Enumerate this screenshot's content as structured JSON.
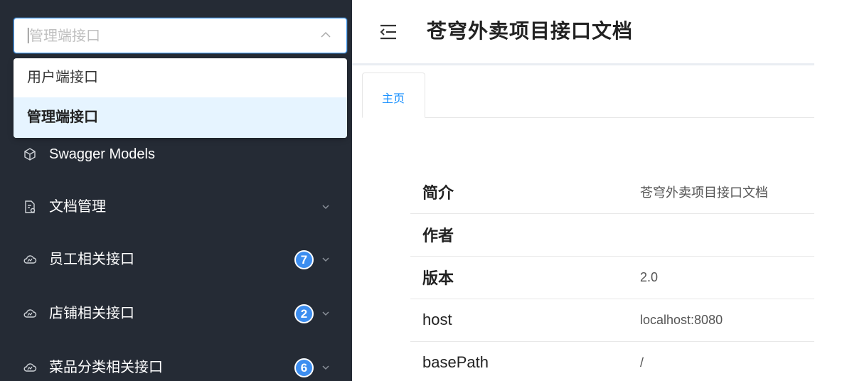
{
  "sidebar": {
    "group_select": {
      "value": "管理端接口"
    },
    "dropdown_options": [
      {
        "label": "用户端接口",
        "selected": false
      },
      {
        "label": "管理端接口",
        "selected": true
      }
    ],
    "items": [
      {
        "label": "Swagger Models",
        "icon": "cube-icon"
      },
      {
        "label": "文档管理",
        "icon": "doc-settings-icon"
      },
      {
        "label": "员工相关接口",
        "icon": "cloud-icon",
        "count": "7"
      },
      {
        "label": "店铺相关接口",
        "icon": "cloud-icon",
        "count": "2"
      },
      {
        "label": "菜品分类相关接口",
        "icon": "cloud-icon",
        "count": "6"
      }
    ],
    "colors": {
      "bg": "#252b35",
      "badge": "#3d8ef0",
      "accent": "#4a9ff5"
    }
  },
  "header": {
    "title": "苍穹外卖项目接口文档"
  },
  "tabs": [
    {
      "label": "主页",
      "active": true
    }
  ],
  "info": {
    "rows": [
      {
        "key": "简介",
        "value": "苍穹外卖项目接口文档"
      },
      {
        "key": "作者",
        "value": ""
      },
      {
        "key": "版本",
        "value": "2.0"
      },
      {
        "key": "host",
        "value": "localhost:8080"
      },
      {
        "key": "basePath",
        "value": "/"
      }
    ]
  }
}
